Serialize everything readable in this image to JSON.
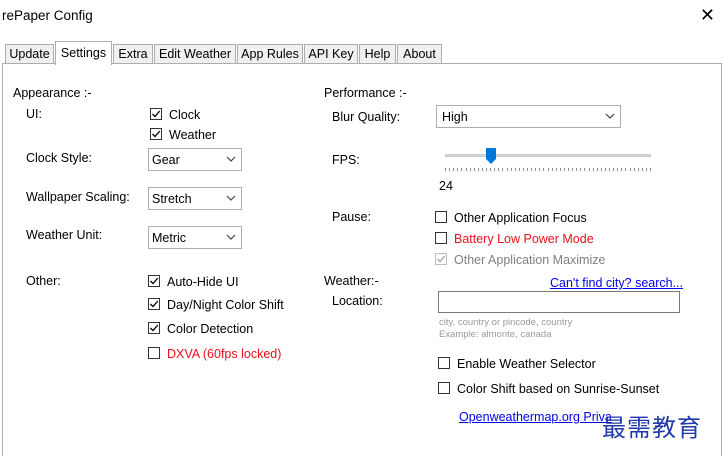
{
  "window": {
    "title": "rePaper Config",
    "close_glyph": "✕"
  },
  "tabs": [
    "Update",
    "Settings",
    "Extra",
    "Edit Weather",
    "App Rules",
    "API Key",
    "Help",
    "About"
  ],
  "active_tab": "Settings",
  "appearance": {
    "heading": "Appearance :-",
    "ui_label": "UI:",
    "ui_options": [
      {
        "label": "Clock",
        "checked": true
      },
      {
        "label": "Weather",
        "checked": true
      }
    ],
    "clock_style_label": "Clock Style:",
    "clock_style_value": "Gear",
    "wallpaper_scaling_label": "Wallpaper Scaling:",
    "wallpaper_scaling_value": "Stretch",
    "weather_unit_label": "Weather Unit:",
    "weather_unit_value": "Metric",
    "other_label": "Other:",
    "other_options": [
      {
        "label": "Auto-Hide UI",
        "checked": true
      },
      {
        "label": "Day/Night Color Shift",
        "checked": true
      },
      {
        "label": "Color Detection",
        "checked": true
      },
      {
        "label": "DXVA (60fps locked)",
        "checked": false,
        "color": "#e8101b"
      }
    ]
  },
  "performance": {
    "heading": "Performance :-",
    "blur_quality_label": "Blur Quality:",
    "blur_quality_value": "High",
    "fps_label": "FPS:",
    "fps_value": "24",
    "fps_slider_fraction": 0.21,
    "pause_label": "Pause:",
    "pause_options": [
      {
        "label": "Other Application Focus",
        "checked": false,
        "disabled": false
      },
      {
        "label": "Battery Low Power Mode",
        "checked": false,
        "disabled": false,
        "color": "#e8101b"
      },
      {
        "label": "Other Application Maximize",
        "checked": true,
        "disabled": true
      }
    ]
  },
  "weather": {
    "heading": "Weather:-",
    "search_link": "Can't find city? search...",
    "location_label": "Location:",
    "location_value": "",
    "hint_line1": "city, country or pincode, country",
    "hint_line2": "Example: almonte, canada",
    "options": [
      {
        "label": "Enable Weather Selector",
        "checked": false
      },
      {
        "label": "Color Shift based on Sunrise-Sunset",
        "checked": false
      }
    ],
    "privacy_link": "Openweathermap.org Priva"
  },
  "watermark": "最需教育"
}
